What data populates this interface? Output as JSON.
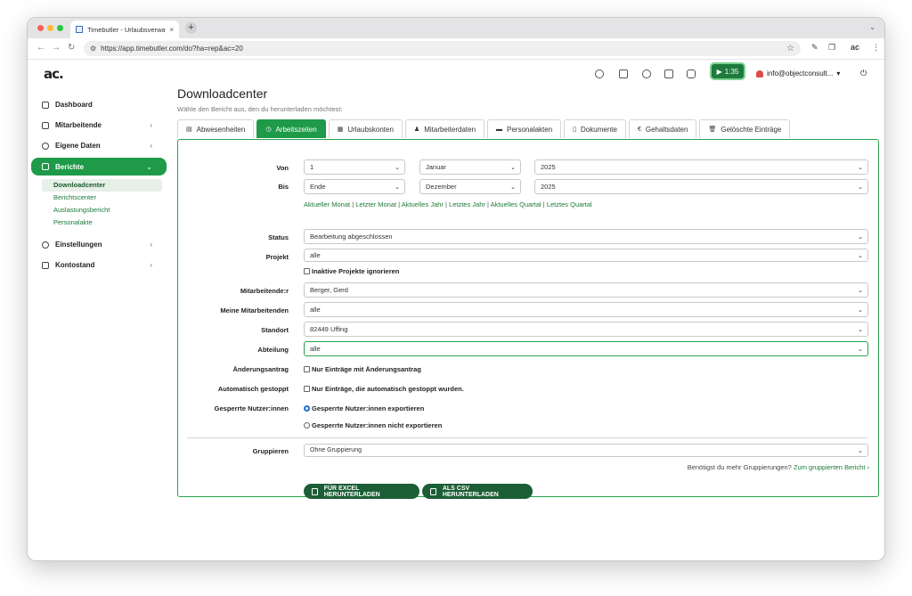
{
  "browser": {
    "tab_title": "Timebutler - Urlaubsverwaltu",
    "url": "https://app.timebutler.com/do?ha=rep&ac=20"
  },
  "header": {
    "logo": "ac.",
    "timer": "1:35",
    "user": "info@objectconsult..."
  },
  "sidebar": {
    "items": [
      {
        "label": "Dashboard",
        "icon": "home-icon"
      },
      {
        "label": "Mitarbeitende",
        "icon": "book-icon"
      },
      {
        "label": "Eigene Daten",
        "icon": "person-icon"
      },
      {
        "label": "Berichte",
        "icon": "chart-icon"
      },
      {
        "label": "Einstellungen",
        "icon": "gear-icon"
      },
      {
        "label": "Kontostand",
        "icon": "wallet-icon"
      }
    ],
    "submenu": [
      "Downloadcenter",
      "Berichtscenter",
      "Auslastungsbericht",
      "Personalakte"
    ]
  },
  "main": {
    "title": "Downloadcenter",
    "subtitle": "Wähle den Bericht aus, den du herunterladen möchtest:",
    "tabs": [
      "Abwesenheiten",
      "Arbeitszeiten",
      "Urlaubskonten",
      "Mitarbeiterdaten",
      "Personalakten",
      "Dokumente",
      "Gehaltsdaten",
      "Gelöschte Einträge"
    ]
  },
  "form": {
    "von_label": "Von",
    "von_day": "1",
    "von_month": "Januar",
    "von_year": "2025",
    "bis_label": "Bis",
    "bis_day": "Ende",
    "bis_month": "Dezember",
    "bis_year": "2025",
    "quick_links": [
      "Aktueller Monat",
      "Letzter Monat",
      "Aktuelles Jahr",
      "Letztes Jahr",
      "Aktuelles Quartal",
      "Letztes Quartal"
    ],
    "status_label": "Status",
    "status_value": "Bearbeitung abgeschlossen",
    "projekt_label": "Projekt",
    "projekt_value": "alle",
    "inactive_projects": "Inaktive Projekte ignorieren",
    "mitarbeitende_label": "Mitarbeitende:r",
    "mitarbeitende_value": "Berger, Gerd",
    "meine_label": "Meine Mitarbeitenden",
    "meine_value": "alle",
    "standort_label": "Standort",
    "standort_value": "82449 Uffing",
    "abteilung_label": "Abteilung",
    "abteilung_value": "alle",
    "aenderung_label": "Änderungsantrag",
    "aenderung_check": "Nur Einträge mit Änderungsantrag",
    "auto_label": "Automatisch gestoppt",
    "auto_check": "Nur Einträge, die automatisch gestoppt wurden.",
    "gesperrt_label": "Gesperrte Nutzer:innen",
    "gesperrt_export": "Gesperrte Nutzer:innen exportieren",
    "gesperrt_no_export": "Gesperrte Nutzer:innen nicht exportieren",
    "gruppieren_label": "Gruppieren",
    "gruppieren_value": "Ohne Gruppierung",
    "more_text": "Benötigst du mehr Gruppierungen?",
    "more_link": "Zum gruppierten Bericht ›",
    "excel_btn": "FÜR EXCEL HERUNTERLADEN",
    "csv_btn": "ALS CSV HERUNTERLADEN"
  },
  "colors": {
    "accent": "#1e9a48",
    "dark_button": "#1c5e36",
    "link": "#1b7a38"
  }
}
